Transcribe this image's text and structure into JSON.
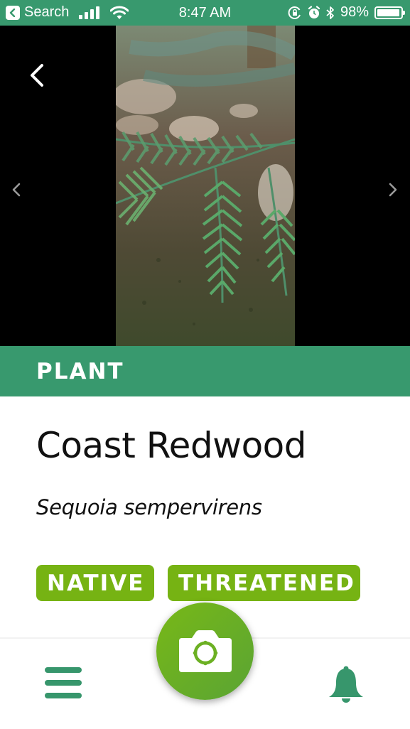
{
  "status_bar": {
    "back_app_label": "Search",
    "time": "8:47 AM",
    "battery_percent_label": "98%",
    "battery_level": 0.98,
    "icons": [
      "back-app-icon",
      "cellular-signal-icon",
      "wifi-icon",
      "orientation-lock-icon",
      "alarm-icon",
      "bluetooth-icon",
      "battery-icon"
    ]
  },
  "gallery": {
    "photo_alt": "Coast Redwood foliage photo",
    "back_icon": "chevron-left-icon",
    "prev_icon": "chevron-left-icon",
    "next_icon": "chevron-right-icon"
  },
  "category": {
    "label": "PLANT"
  },
  "species": {
    "common_name": "Coast Redwood",
    "scientific_name": "Sequoia sempervirens"
  },
  "tags": [
    {
      "label": "NATIVE"
    },
    {
      "label": "THREATENED"
    }
  ],
  "bottom_nav": {
    "menu_icon": "hamburger-menu-icon",
    "camera_icon": "camera-icon",
    "notifications_icon": "bell-icon"
  },
  "colors": {
    "brand_green": "#38996e",
    "tag_green": "#76b313",
    "camera_green": "#6cb023"
  }
}
